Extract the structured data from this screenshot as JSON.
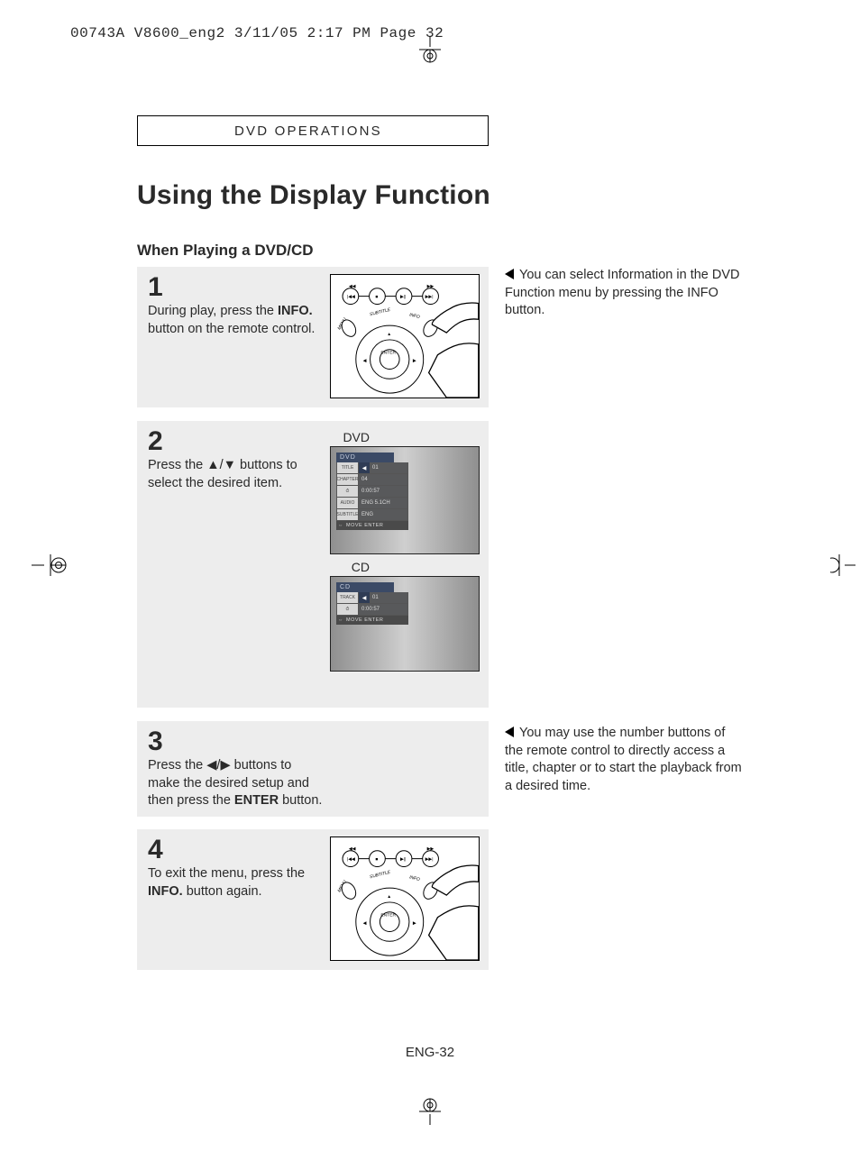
{
  "header": "00743A V8600_eng2  3/11/05  2:17 PM  Page 32",
  "section_label": "DVD OPERATIONS",
  "title": "Using the Display Function",
  "subtitle": "When Playing a DVD/CD",
  "steps": {
    "s1": {
      "num": "1",
      "text_before": "During play, press the ",
      "bold": "INFO.",
      "text_after": " button on the remote control."
    },
    "s2": {
      "num": "2",
      "text_before": "Press the ",
      "symbols": "▲/▼",
      "text_after": " buttons to select the desired item.",
      "label_dvd": "DVD",
      "label_cd": "CD",
      "osd_dvd": {
        "title": "DVD",
        "rows": [
          {
            "tag": "TITLE",
            "sel": "",
            "val": "01"
          },
          {
            "tag": "CHAPTER",
            "sel": "",
            "val": "04"
          },
          {
            "tag": "",
            "sel": "",
            "val": "0:00:57"
          },
          {
            "tag": "AUDIO",
            "sel": "",
            "val": "ENG 5.1CH"
          },
          {
            "tag": "SUBTITLE",
            "sel": "",
            "val": "ENG"
          }
        ],
        "footer": "MOVE   ENTER"
      },
      "osd_cd": {
        "title": "CD",
        "rows": [
          {
            "tag": "TRACK",
            "sel": "",
            "val": "01"
          },
          {
            "tag": "",
            "sel": "",
            "val": "0:00:57"
          }
        ],
        "footer": "MOVE   ENTER"
      }
    },
    "s3": {
      "num": "3",
      "text_before": "Press the ",
      "symbols": "◀/▶",
      "text_mid": " buttons to make the desired setup and then press the ",
      "bold": "ENTER",
      "text_after": " button."
    },
    "s4": {
      "num": "4",
      "text_before": "To exit the menu, press the ",
      "bold": "INFO.",
      "text_after": " button again."
    }
  },
  "notes": {
    "n1": "You can select Information in the DVD Function menu by pressing the INFO button.",
    "n2": "You may use the number buttons of the remote control to directly access a title, chapter or to start the playback from a desired time."
  },
  "remote_labels": {
    "subtitle": "SUBTITLE",
    "info": "INFO",
    "menu": "MENU",
    "enter": "ENTER"
  },
  "page_number": "ENG-32"
}
